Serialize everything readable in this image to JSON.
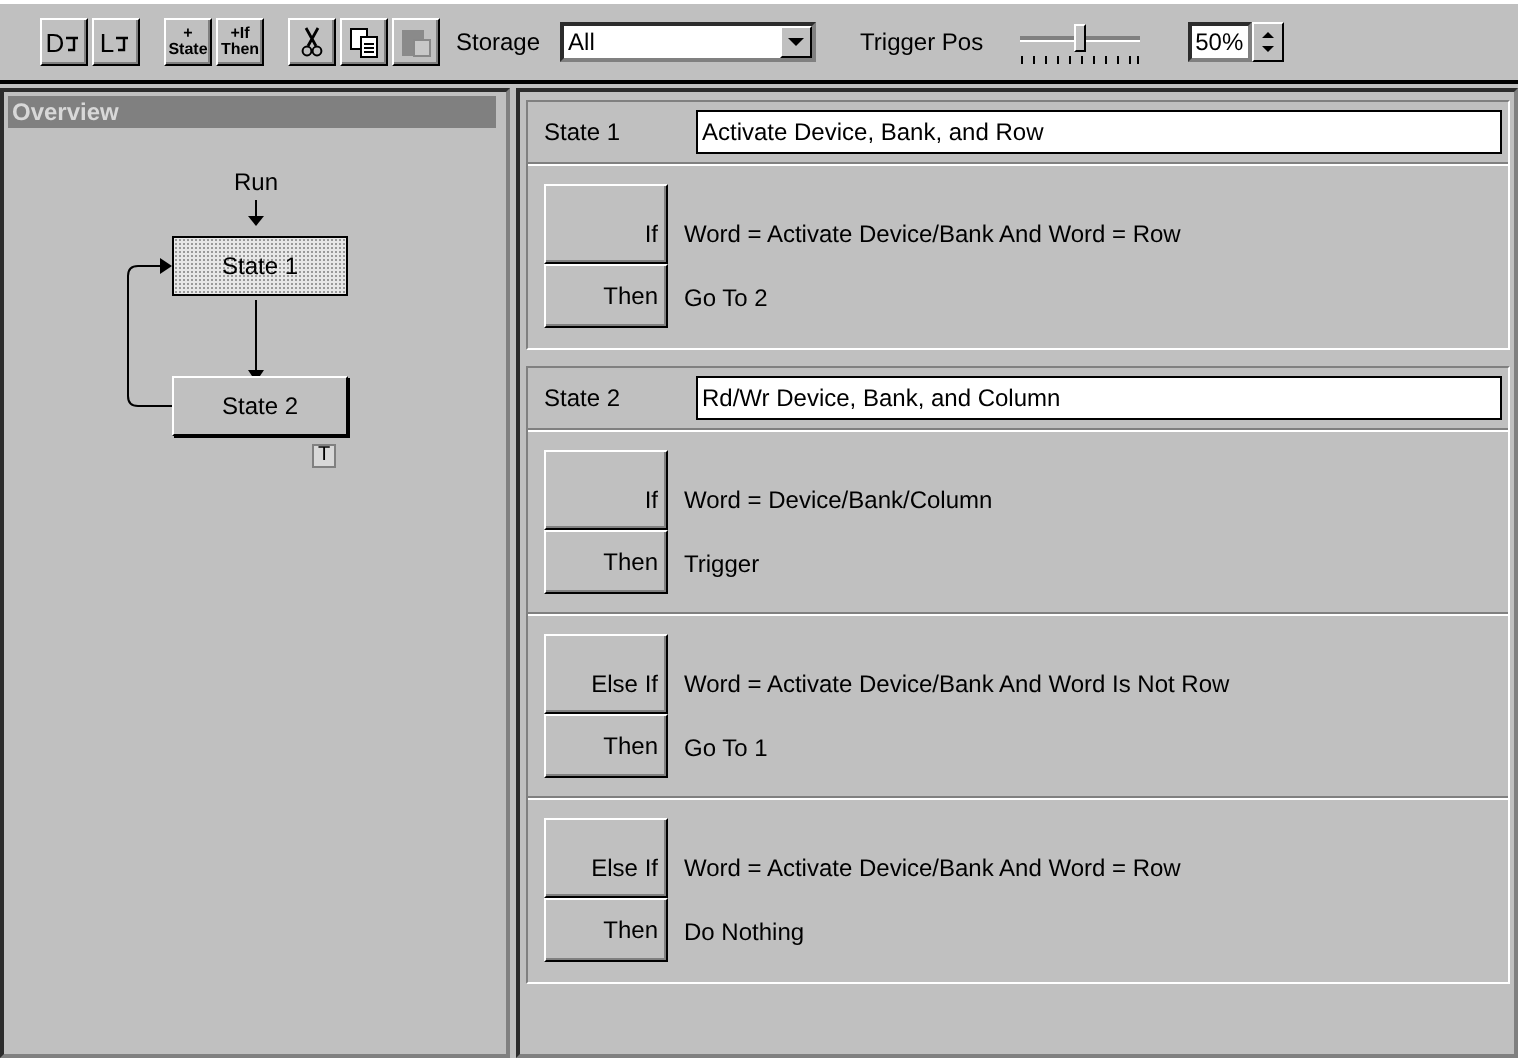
{
  "toolbar": {
    "buttons": [
      {
        "kind": "wave",
        "label": "D"
      },
      {
        "kind": "wave",
        "label": "L"
      },
      {
        "kind": "add",
        "top": "+",
        "bottom": "State"
      },
      {
        "kind": "add",
        "top": "+If",
        "bottom": "Then"
      },
      {
        "kind": "cut",
        "disabled": false
      },
      {
        "kind": "copy",
        "disabled": false
      },
      {
        "kind": "paste",
        "disabled": true
      }
    ],
    "storage": {
      "label": "Storage",
      "value": "All"
    },
    "trigger": {
      "label": "Trigger Pos",
      "level": 0.5,
      "value": "50%"
    }
  },
  "overview": {
    "title": "Overview",
    "start": "Run",
    "nodes": [
      {
        "label": "State 1",
        "selected": true
      },
      {
        "label": "State 2",
        "selected": false,
        "marker": "T"
      }
    ]
  },
  "states": [
    {
      "label": "State 1",
      "name": "Activate Device, Bank, and Row",
      "clauses": [
        {
          "if_label": "If",
          "condition": "Word = Activate Device/Bank And Word = Row",
          "then_label": "Then",
          "action": "Go To 2"
        }
      ]
    },
    {
      "label": "State 2",
      "name": "Rd/Wr Device, Bank, and Column",
      "clauses": [
        {
          "if_label": "If",
          "condition": "Word = Device/Bank/Column",
          "then_label": "Then",
          "action": "Trigger"
        },
        {
          "if_label": "Else If",
          "condition": "Word = Activate Device/Bank And Word Is Not Row",
          "then_label": "Then",
          "action": "Go To 1"
        },
        {
          "if_label": "Else If",
          "condition": "Word = Activate Device/Bank And Word = Row",
          "then_label": "Then",
          "action": "Do Nothing"
        }
      ]
    }
  ]
}
